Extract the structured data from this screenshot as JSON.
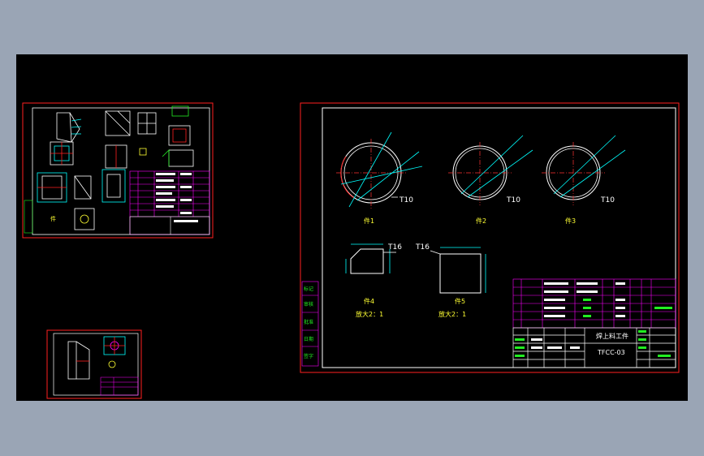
{
  "viewport": {
    "background": "#9aa5b5",
    "canvas_background": "#000000"
  },
  "colors": {
    "frame": "#ff2020",
    "border": "#ffffff",
    "table": "#ff00ff",
    "dimension": "#00ffff",
    "centerline": "#ff3333",
    "label": "#ffff33",
    "green": "#22ee22"
  },
  "sheet_main": {
    "parts": [
      {
        "label": "件1",
        "thickness": "T10"
      },
      {
        "label": "件2",
        "thickness": "T10"
      },
      {
        "label": "件3",
        "thickness": "T10"
      }
    ],
    "details": [
      {
        "label": "件4",
        "thickness": "T16",
        "scale": "放大2：1"
      },
      {
        "label": "件5",
        "thickness": "T16",
        "scale": "放大2：1"
      }
    ],
    "title_block": {
      "name": "焊上料工件",
      "drawing_no": "TFCC-03"
    },
    "left_strip_labels": [
      "标记",
      "审核",
      "批准",
      "日期",
      "签字"
    ]
  },
  "sheet_top_left": {
    "part_label": "件"
  },
  "sheet_bottom_left": {}
}
